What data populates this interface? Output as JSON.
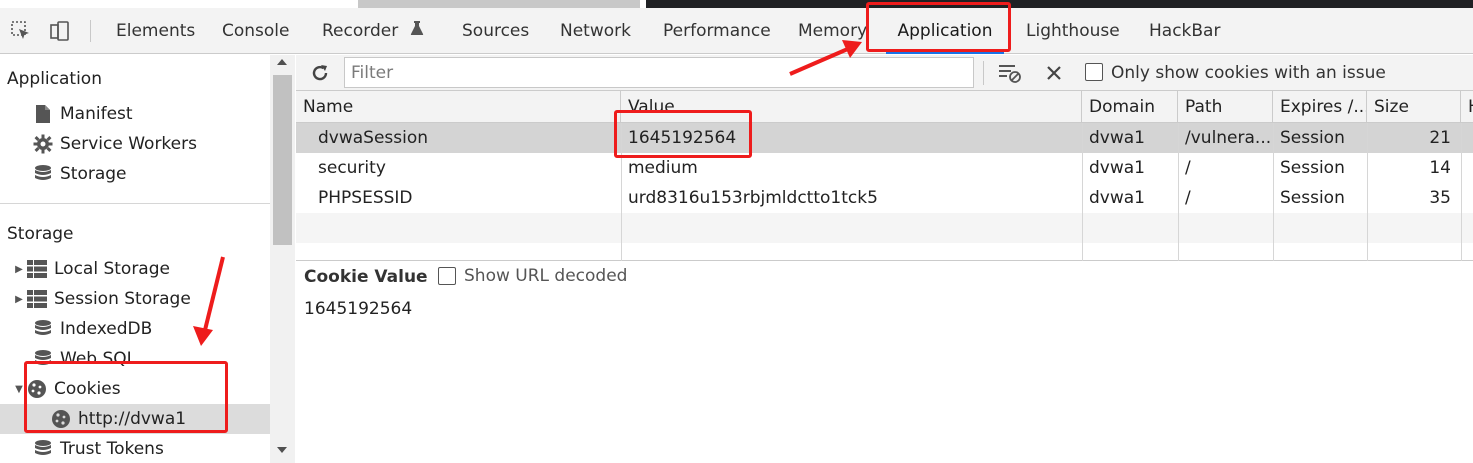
{
  "tabs": [
    {
      "label": "Elements"
    },
    {
      "label": "Console"
    },
    {
      "label": "Recorder"
    },
    {
      "label": "Sources"
    },
    {
      "label": "Network"
    },
    {
      "label": "Performance"
    },
    {
      "label": "Memory"
    },
    {
      "label": "Application"
    },
    {
      "label": "Lighthouse"
    },
    {
      "label": "HackBar"
    }
  ],
  "active_tab": "Application",
  "sidebar": {
    "application_heading": "Application",
    "application_items": [
      {
        "label": "Manifest",
        "icon": "file-icon"
      },
      {
        "label": "Service Workers",
        "icon": "gear-icon"
      },
      {
        "label": "Storage",
        "icon": "database-icon"
      }
    ],
    "storage_heading": "Storage",
    "storage_items": [
      {
        "label": "Local Storage",
        "icon": "grid-icon"
      },
      {
        "label": "Session Storage",
        "icon": "grid-icon"
      },
      {
        "label": "IndexedDB",
        "icon": "database-icon"
      },
      {
        "label": "Web SQL",
        "icon": "database-icon"
      },
      {
        "label": "Cookies",
        "icon": "cookie-icon"
      },
      {
        "label": "http://dvwa1",
        "icon": "cookie-icon"
      },
      {
        "label": "Trust Tokens",
        "icon": "database-icon"
      }
    ]
  },
  "toolbar": {
    "filter_placeholder": "Filter",
    "only_issues_label": "Only show cookies with an issue"
  },
  "table": {
    "columns": [
      "Name",
      "Value",
      "Domain",
      "Path",
      "Expires /...",
      "Size",
      "H"
    ],
    "rows": [
      [
        "dvwaSession",
        "1645192564",
        "dvwa1",
        "/vulnera...",
        "Session",
        "21"
      ],
      [
        "security",
        "medium",
        "dvwa1",
        "/",
        "Session",
        "14"
      ],
      [
        "PHPSESSID",
        "urd8316u153rbjmldctto1tck5",
        "dvwa1",
        "/",
        "Session",
        "35"
      ]
    ]
  },
  "cookie_value": {
    "title": "Cookie Value",
    "decode_label": "Show URL decoded",
    "value": "1645192564"
  },
  "colors": {
    "annotation_red": "#ee1c1c",
    "selected_row": "#d4d4d4"
  }
}
